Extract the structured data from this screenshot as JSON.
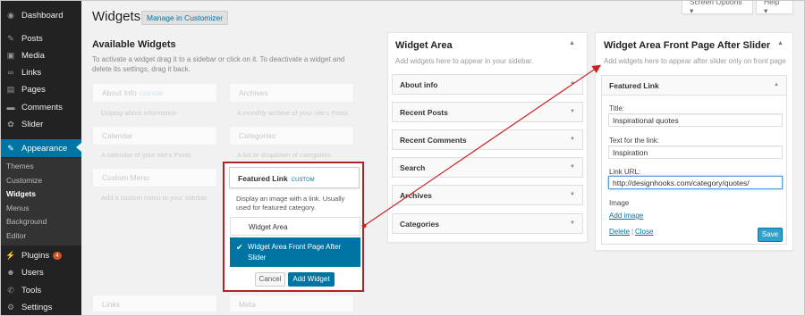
{
  "sidebar": {
    "items": [
      {
        "label": "Dashboard",
        "icon": "dashboard-icon",
        "glyph": "◉"
      },
      {
        "label": "Posts",
        "icon": "pin-icon",
        "glyph": "✎"
      },
      {
        "label": "Media",
        "icon": "media-icon",
        "glyph": "▣"
      },
      {
        "label": "Links",
        "icon": "link-icon",
        "glyph": "∞"
      },
      {
        "label": "Pages",
        "icon": "pages-icon",
        "glyph": "▤"
      },
      {
        "label": "Comments",
        "icon": "comments-icon",
        "glyph": "▬"
      },
      {
        "label": "Slider",
        "icon": "gear-icon",
        "glyph": "✿"
      },
      {
        "label": "Appearance",
        "icon": "brush-icon",
        "glyph": "✎"
      }
    ],
    "submenu": [
      "Themes",
      "Customize",
      "Widgets",
      "Menus",
      "Background",
      "Editor"
    ],
    "lower": [
      {
        "label": "Plugins",
        "icon": "plugin-icon",
        "glyph": "⚡",
        "badge": "4"
      },
      {
        "label": "Users",
        "icon": "users-icon",
        "glyph": "☻"
      },
      {
        "label": "Tools",
        "icon": "wrench-icon",
        "glyph": "✆"
      },
      {
        "label": "Settings",
        "icon": "settings-icon",
        "glyph": "⚙"
      }
    ]
  },
  "header": {
    "title": "Widgets",
    "customizer_button": "Manage in Customizer",
    "screen_options": "Screen Options ▾",
    "help": "Help ▾"
  },
  "available": {
    "title": "Available Widgets",
    "description": "To activate a widget drag it to a sidebar or click on it. To deactivate a widget and delete its settings, drag it back.",
    "widgets": [
      {
        "name": "About Info",
        "custom": "CUSTOM",
        "desc": "Display about information"
      },
      {
        "name": "Archives",
        "custom": "",
        "desc": "A monthly archive of your site's Posts."
      },
      {
        "name": "Calendar",
        "custom": "",
        "desc": "A calendar of your site's Posts."
      },
      {
        "name": "Categories",
        "custom": "",
        "desc": "A list or dropdown of categories."
      },
      {
        "name": "Custom Menu",
        "custom": "",
        "desc": "Add a custom menu to your sidebar."
      },
      {
        "name": "",
        "custom": "",
        "desc": ""
      },
      {
        "name": "Links",
        "custom": "",
        "desc": ""
      },
      {
        "name": "Meta",
        "custom": "",
        "desc": ""
      }
    ]
  },
  "chooser": {
    "widget_name": "Featured Link",
    "custom_tag": "CUSTOM",
    "description": "Display an image with a link. Usually used for featured category.",
    "options": [
      "Widget Area",
      "Widget Area Front Page After Slider"
    ],
    "selected_index": 1,
    "cancel": "Cancel",
    "add": "Add Widget"
  },
  "widget_area": {
    "title": "Widget Area",
    "description": "Add widgets here to appear in your sidebar.",
    "widgets": [
      "About info",
      "Recent Posts",
      "Recent Comments",
      "Search",
      "Archives",
      "Categories"
    ]
  },
  "front_area": {
    "title": "Widget Area Front Page After Slider",
    "description": "Add widgets here to appear after slider only on front page",
    "featured": {
      "header": "Featured Link",
      "title_label": "Title:",
      "title_value": "Inspirational quotes",
      "text_label": "Text for the link:",
      "text_value": "Inspiration",
      "url_label": "Link URL:",
      "url_value": "http://designhooks.com/category/quotes/",
      "image_label": "Image",
      "add_image": "Add image",
      "delete": "Delete",
      "separator": "|",
      "close": "Close",
      "save": "Save"
    }
  },
  "colors": {
    "accent": "#0074a2",
    "annotation": "#cc2222",
    "primary_button": "#2ea2cc"
  }
}
